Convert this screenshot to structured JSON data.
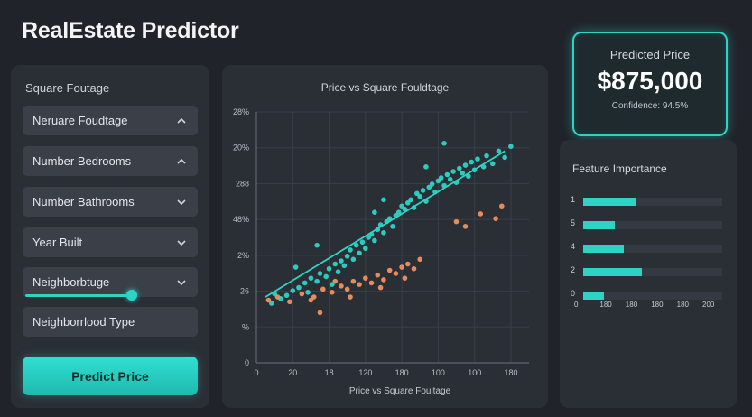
{
  "app": {
    "title": "RealEstate Predictor"
  },
  "inputs": {
    "section_label": "Square Foutage",
    "fields": [
      {
        "label": "Neruare Foudtage",
        "chevron": "chevron-up-icon"
      },
      {
        "label": "Number Bedrooms",
        "chevron": "chevron-up-icon"
      },
      {
        "label": "Number Bathrooms",
        "chevron": "chevron-down-icon"
      },
      {
        "label": "Year Built",
        "chevron": "chevron-down-icon"
      },
      {
        "label": "Neighborbtuge",
        "chevron": "chevron-down-icon"
      },
      {
        "label": "Neighborrlood Type",
        "chevron": ""
      }
    ],
    "predict_button": "Predict Price"
  },
  "prediction": {
    "label": "Predicted Price",
    "value": "$875,000",
    "confidence": "Confidence: 94.5%"
  },
  "feature_importance": {
    "title": "Feature Importance",
    "rows": [
      {
        "label": "1",
        "value": 0.38
      },
      {
        "label": "5",
        "value": 0.23
      },
      {
        "label": "4",
        "value": 0.29
      },
      {
        "label": "2",
        "value": 0.42
      },
      {
        "label": "0",
        "value": 0.15
      }
    ],
    "x_ticks": [
      "0",
      "180",
      "180",
      "180",
      "180",
      "200"
    ]
  },
  "chart_data": {
    "type": "scatter",
    "title": "Price vs Square Fouldtage",
    "xlabel": "Price vs Square Foultage",
    "ylabel": "",
    "x_ticks": [
      "0",
      "20",
      "18",
      "120",
      "180",
      "100",
      "100",
      "180"
    ],
    "y_ticks": [
      "28%",
      "20%",
      "288",
      "48%",
      "2%",
      "26",
      "%",
      "0"
    ],
    "grid": true,
    "series": [
      {
        "color": "#2ed3c6",
        "points": [
          [
            0.5,
            0.08
          ],
          [
            0.6,
            0.14
          ],
          [
            0.8,
            0.11
          ],
          [
            1.0,
            0.13
          ],
          [
            1.2,
            0.16
          ],
          [
            1.4,
            0.18
          ],
          [
            1.6,
            0.21
          ],
          [
            1.7,
            0.15
          ],
          [
            1.8,
            0.24
          ],
          [
            2.0,
            0.22
          ],
          [
            2.1,
            0.27
          ],
          [
            2.3,
            0.25
          ],
          [
            2.4,
            0.3
          ],
          [
            2.5,
            0.2
          ],
          [
            2.6,
            0.33
          ],
          [
            2.7,
            0.28
          ],
          [
            2.8,
            0.35
          ],
          [
            2.9,
            0.32
          ],
          [
            3.0,
            0.38
          ],
          [
            3.1,
            0.42
          ],
          [
            3.2,
            0.36
          ],
          [
            3.3,
            0.45
          ],
          [
            3.4,
            0.4
          ],
          [
            3.5,
            0.47
          ],
          [
            3.6,
            0.43
          ],
          [
            3.7,
            0.5
          ],
          [
            3.8,
            0.52
          ],
          [
            3.9,
            0.48
          ],
          [
            4.0,
            0.55
          ],
          [
            4.1,
            0.58
          ],
          [
            4.2,
            0.53
          ],
          [
            4.3,
            0.6
          ],
          [
            4.4,
            0.62
          ],
          [
            4.5,
            0.57
          ],
          [
            4.6,
            0.64
          ],
          [
            4.7,
            0.66
          ],
          [
            4.8,
            0.7
          ],
          [
            4.9,
            0.68
          ],
          [
            5.0,
            0.72
          ],
          [
            5.1,
            0.74
          ],
          [
            5.2,
            0.69
          ],
          [
            5.3,
            0.78
          ],
          [
            5.4,
            0.76
          ],
          [
            5.5,
            0.8
          ],
          [
            5.6,
            0.73
          ],
          [
            5.7,
            0.82
          ],
          [
            5.8,
            0.84
          ],
          [
            5.9,
            0.79
          ],
          [
            6.0,
            0.86
          ],
          [
            6.1,
            0.88
          ],
          [
            6.2,
            0.83
          ],
          [
            6.3,
            0.9
          ],
          [
            6.4,
            0.87
          ],
          [
            6.5,
            0.92
          ],
          [
            6.6,
            0.85
          ],
          [
            6.7,
            0.94
          ],
          [
            6.8,
            0.91
          ],
          [
            6.9,
            0.96
          ],
          [
            7.0,
            0.89
          ],
          [
            7.1,
            0.98
          ],
          [
            7.2,
            0.93
          ],
          [
            7.3,
            1.0
          ],
          [
            7.5,
            0.95
          ],
          [
            7.6,
            1.02
          ],
          [
            7.8,
            0.97
          ],
          [
            8.0,
            1.05
          ],
          [
            8.2,
            1.01
          ],
          [
            8.4,
            1.08
          ],
          [
            4.2,
            0.74
          ],
          [
            3.9,
            0.66
          ],
          [
            5.6,
            0.95
          ],
          [
            6.2,
            1.1
          ],
          [
            2.0,
            0.45
          ],
          [
            1.3,
            0.31
          ]
        ]
      },
      {
        "color": "#f0905f",
        "points": [
          [
            0.4,
            0.1
          ],
          [
            0.7,
            0.12
          ],
          [
            1.1,
            0.09
          ],
          [
            1.5,
            0.14
          ],
          [
            1.9,
            0.12
          ],
          [
            2.2,
            0.17
          ],
          [
            2.5,
            0.15
          ],
          [
            2.8,
            0.19
          ],
          [
            3.0,
            0.17
          ],
          [
            3.2,
            0.22
          ],
          [
            3.4,
            0.2
          ],
          [
            3.6,
            0.24
          ],
          [
            3.8,
            0.21
          ],
          [
            4.0,
            0.26
          ],
          [
            4.2,
            0.23
          ],
          [
            4.4,
            0.29
          ],
          [
            4.6,
            0.27
          ],
          [
            4.8,
            0.31
          ],
          [
            5.0,
            0.33
          ],
          [
            5.2,
            0.3
          ],
          [
            5.4,
            0.36
          ],
          [
            6.6,
            0.6
          ],
          [
            6.9,
            0.57
          ],
          [
            7.4,
            0.65
          ],
          [
            7.9,
            0.62
          ],
          [
            8.1,
            0.7
          ],
          [
            2.1,
            0.02
          ],
          [
            1.8,
            0.1
          ],
          [
            2.6,
            0.22
          ],
          [
            3.1,
            0.12
          ],
          [
            4.1,
            0.18
          ],
          [
            4.9,
            0.24
          ]
        ]
      }
    ],
    "trendline": {
      "color": "#2ed3c6",
      "from": [
        0.3,
        0.12
      ],
      "to": [
        8.2,
        1.05
      ]
    },
    "xlim": [
      0,
      9
    ],
    "ylim": [
      -0.3,
      1.3
    ]
  }
}
